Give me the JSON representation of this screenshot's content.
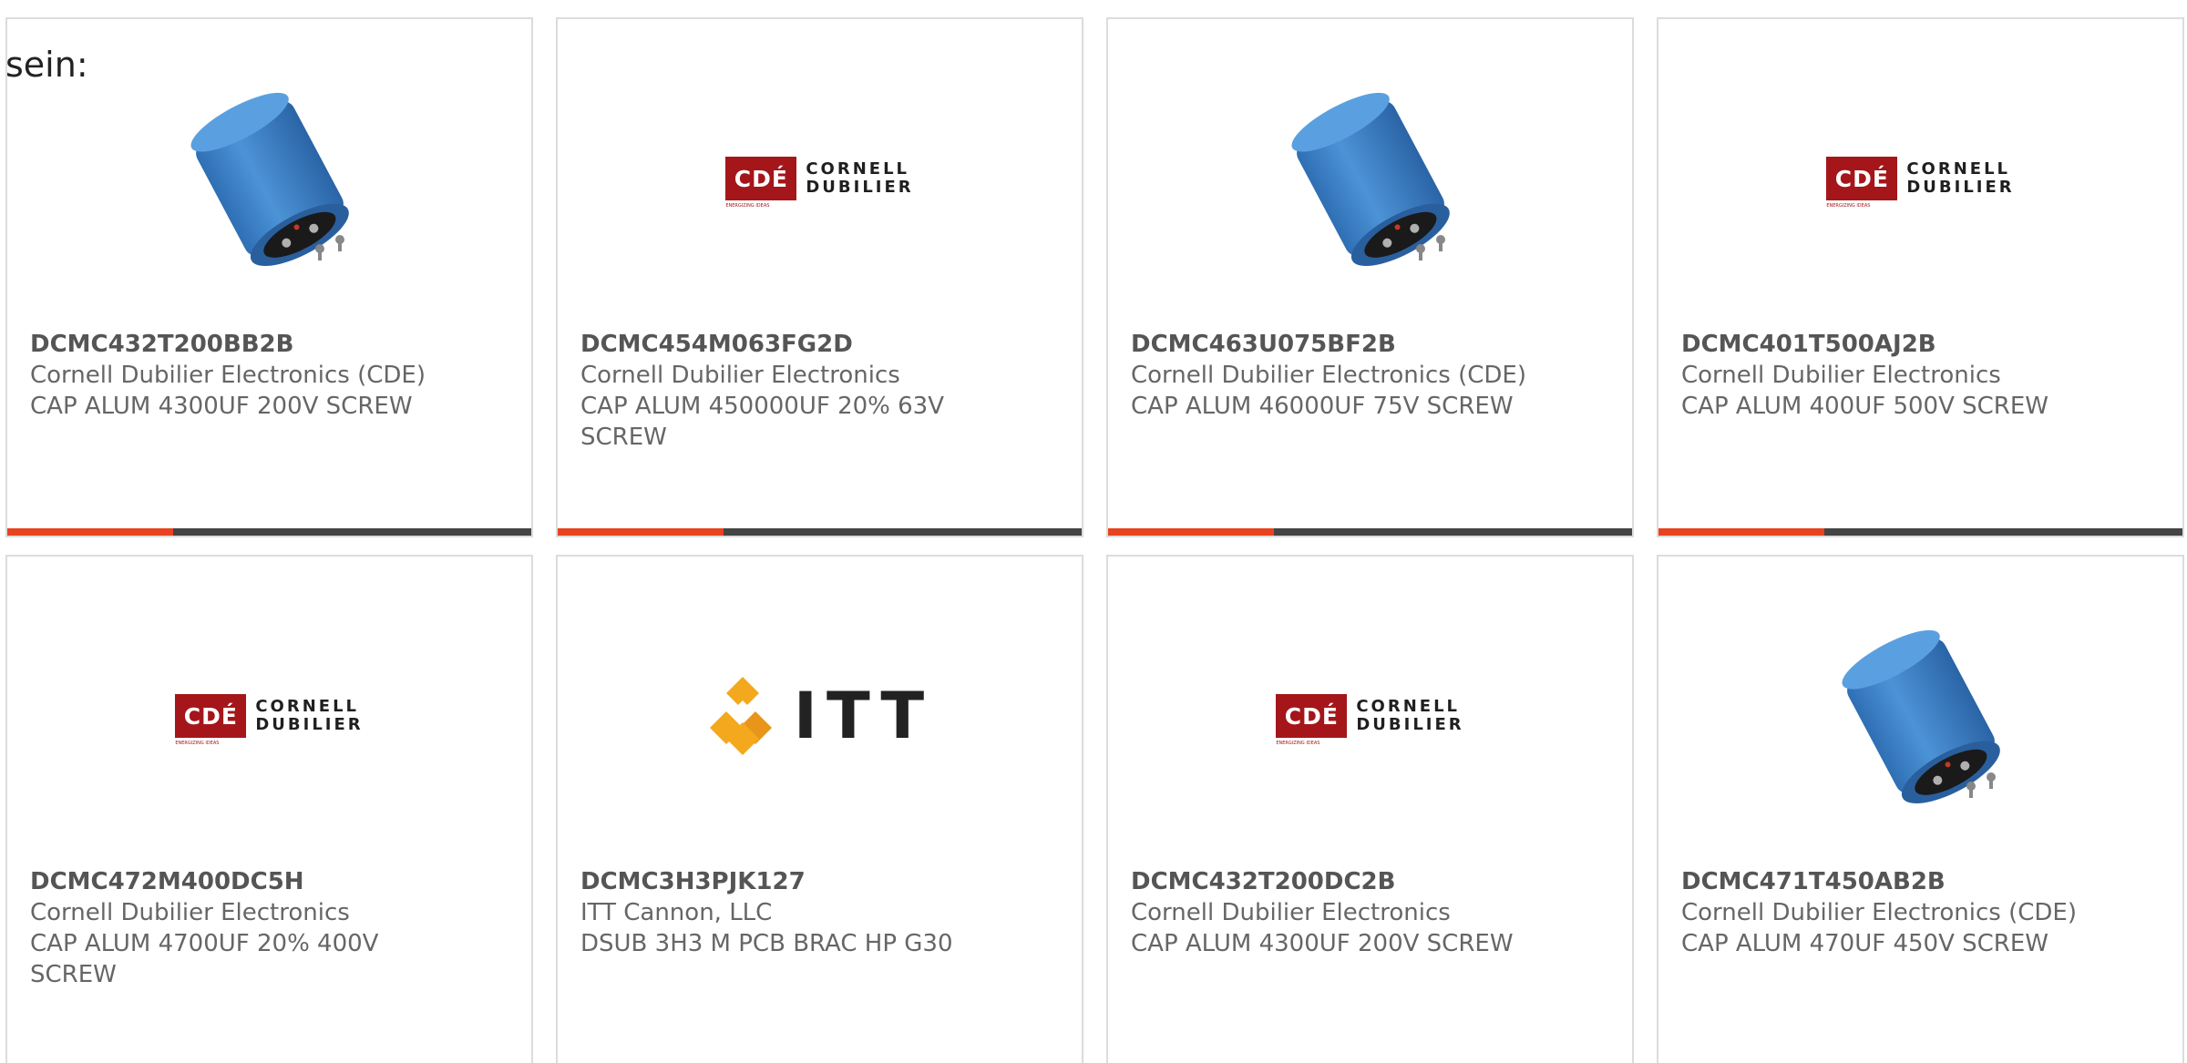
{
  "intro_text": "sein:",
  "logos": {
    "cde_mark": "CDÉ",
    "cde_line1": "CORNELL",
    "cde_line2": "DUBILIER",
    "cde_tagline": "ENERGIZING IDEAS",
    "itt_text": "ITT"
  },
  "colors": {
    "accent": "#e8431f",
    "bar_dark": "#444444",
    "cde_red": "#a4161a",
    "capacitor_blue": "#3b82c4"
  },
  "products": [
    {
      "part_number": "DCMC432T200BB2B",
      "manufacturer": "Cornell Dubilier Electronics (CDE)",
      "description": "CAP ALUM 4300UF 200V SCREW",
      "image": "capacitor-image"
    },
    {
      "part_number": "DCMC454M063FG2D",
      "manufacturer": "Cornell Dubilier Electronics",
      "description": "CAP ALUM 450000UF 20% 63V SCREW",
      "image": "cde-logo"
    },
    {
      "part_number": "DCMC463U075BF2B",
      "manufacturer": "Cornell Dubilier Electronics (CDE)",
      "description": "CAP ALUM 46000UF 75V SCREW",
      "image": "capacitor-image"
    },
    {
      "part_number": "DCMC401T500AJ2B",
      "manufacturer": "Cornell Dubilier Electronics",
      "description": "CAP ALUM 400UF 500V SCREW",
      "image": "cde-logo"
    },
    {
      "part_number": "DCMC472M400DC5H",
      "manufacturer": "Cornell Dubilier Electronics",
      "description": "CAP ALUM 4700UF 20% 400V SCREW",
      "image": "cde-logo"
    },
    {
      "part_number": "DCMC3H3PJK127",
      "manufacturer": "ITT Cannon, LLC",
      "description": "DSUB 3H3 M PCB BRAC HP G30",
      "image": "itt-logo"
    },
    {
      "part_number": "DCMC432T200DC2B",
      "manufacturer": "Cornell Dubilier Electronics",
      "description": "CAP ALUM 4300UF 200V SCREW",
      "image": "cde-logo"
    },
    {
      "part_number": "DCMC471T450AB2B",
      "manufacturer": "Cornell Dubilier Electronics (CDE)",
      "description": "CAP ALUM 470UF 450V SCREW",
      "image": "capacitor-image"
    }
  ]
}
